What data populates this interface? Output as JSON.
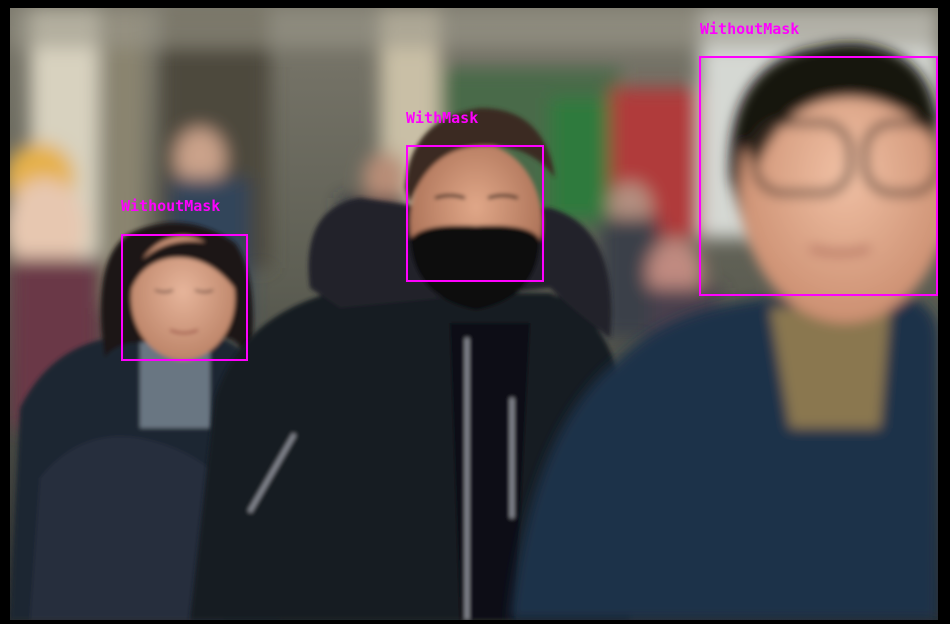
{
  "image": {
    "box_color": "#ff00ff",
    "detections": [
      {
        "label": "WithoutMask"
      },
      {
        "label": "WithMask"
      },
      {
        "label": "WithoutMask"
      }
    ]
  }
}
